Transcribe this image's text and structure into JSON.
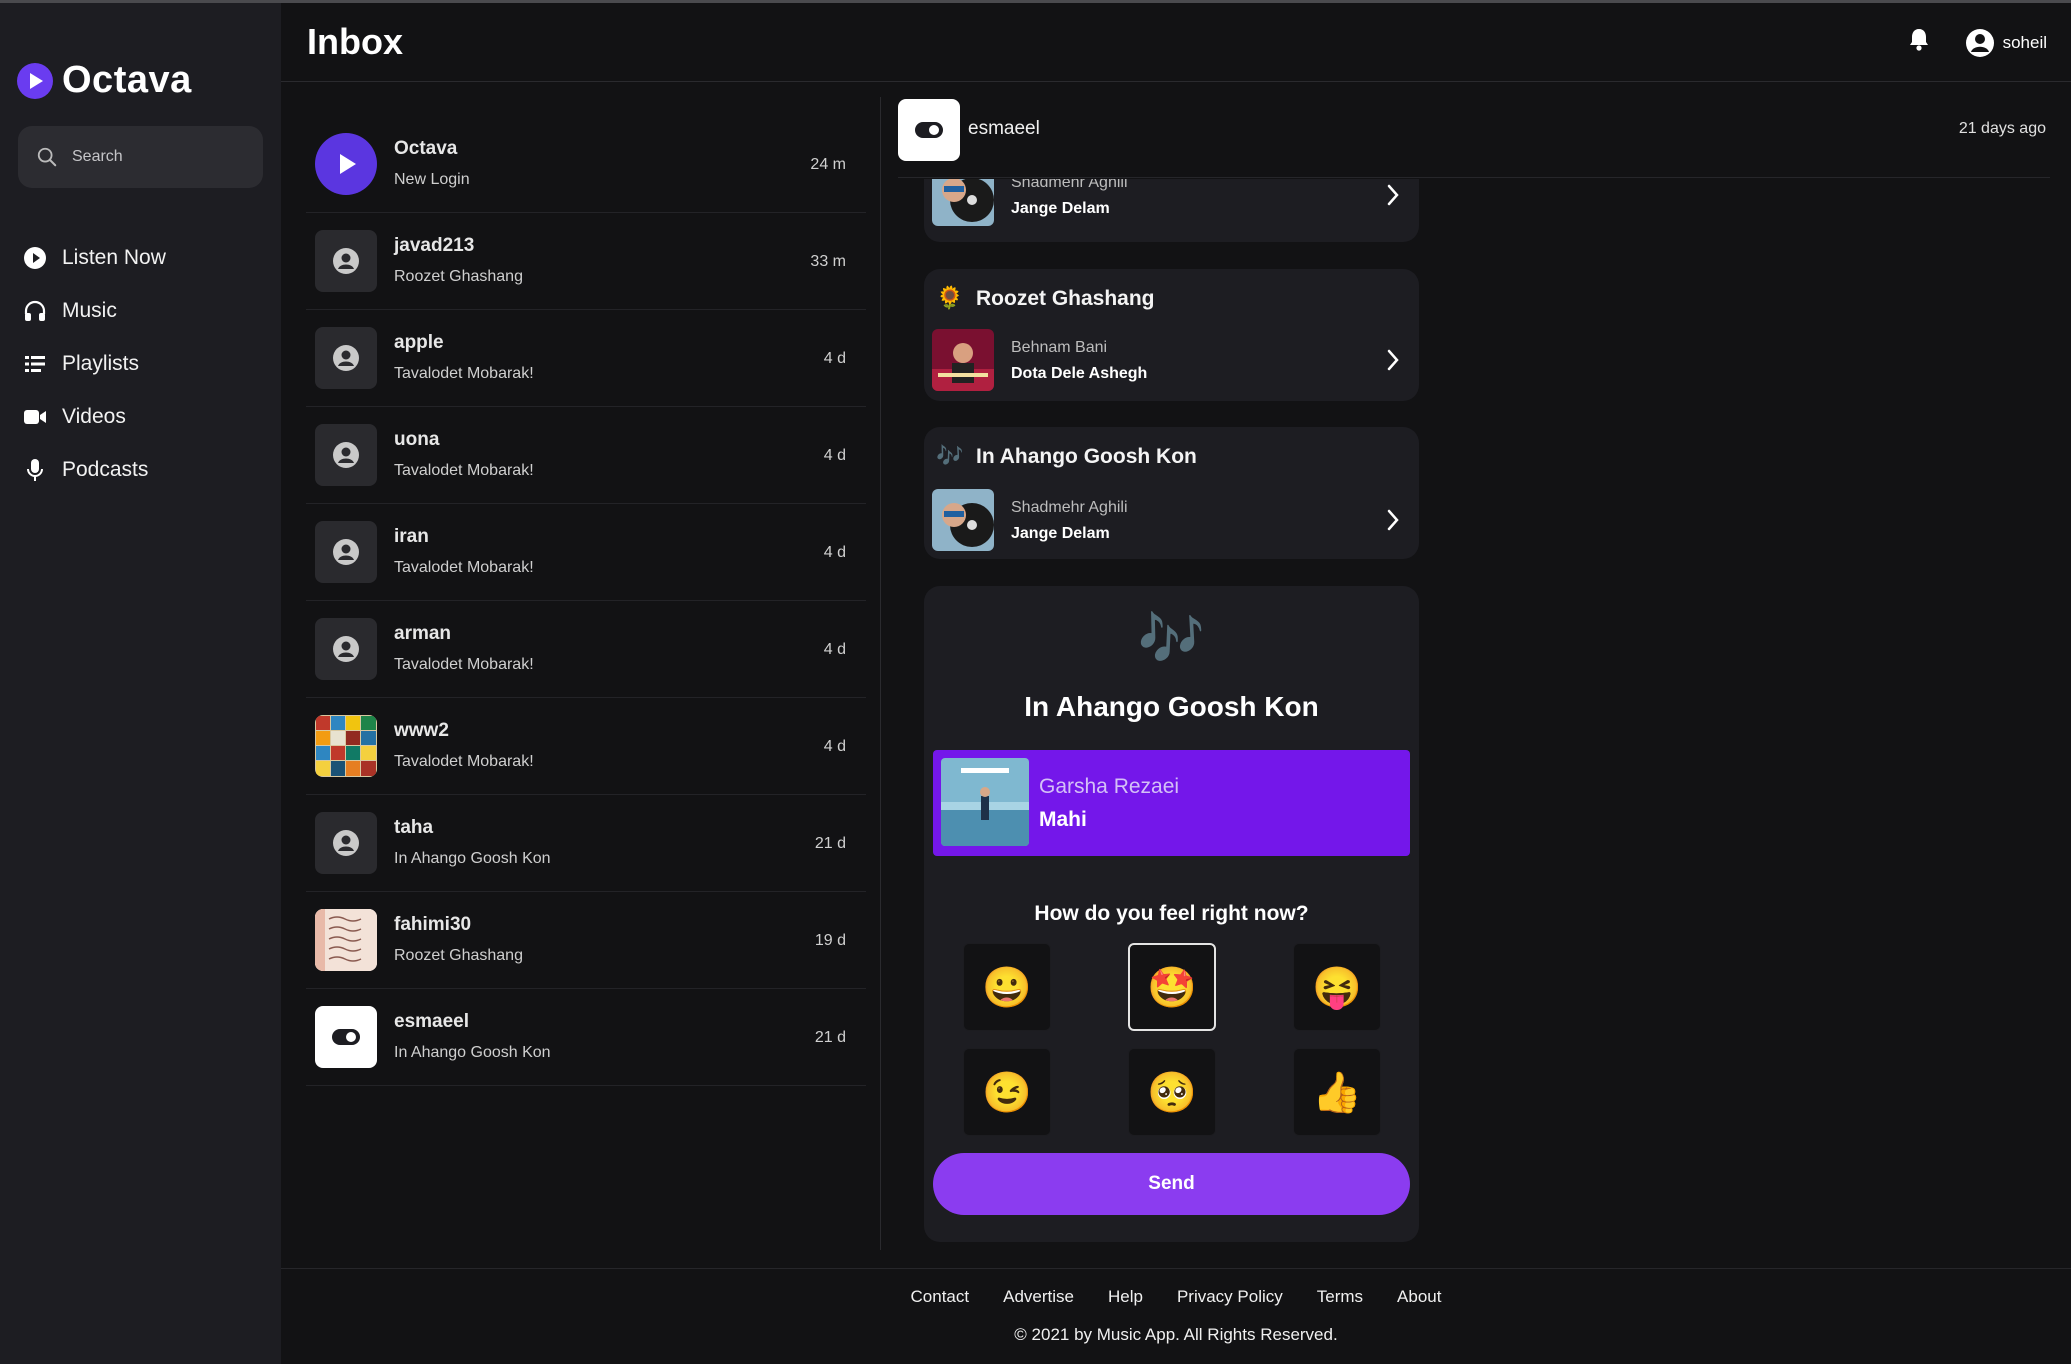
{
  "app": {
    "name": "Octava"
  },
  "search": {
    "placeholder": "Search"
  },
  "nav": [
    {
      "label": "Listen Now",
      "icon": "play-circle-icon"
    },
    {
      "label": "Music",
      "icon": "headphones-icon"
    },
    {
      "label": "Playlists",
      "icon": "playlist-icon"
    },
    {
      "label": "Videos",
      "icon": "video-camera-icon"
    },
    {
      "label": "Podcasts",
      "icon": "microphone-icon"
    }
  ],
  "header": {
    "title": "Inbox",
    "username": "soheil"
  },
  "messages": [
    {
      "name": "Octava",
      "text": "New Login",
      "time": "24 m"
    },
    {
      "name": "javad213",
      "text": "Roozet Ghashang",
      "time": "33 m"
    },
    {
      "name": "apple",
      "text": "Tavalodet Mobarak!",
      "time": "4 d"
    },
    {
      "name": "uona",
      "text": "Tavalodet Mobarak!",
      "time": "4 d"
    },
    {
      "name": "iran",
      "text": "Tavalodet Mobarak!",
      "time": "4 d"
    },
    {
      "name": "arman",
      "text": "Tavalodet Mobarak!",
      "time": "4 d"
    },
    {
      "name": "www2",
      "text": "Tavalodet Mobarak!",
      "time": "4 d"
    },
    {
      "name": "taha",
      "text": "In Ahango Goosh Kon",
      "time": "21 d"
    },
    {
      "name": "fahimi30",
      "text": "Roozet Ghashang",
      "time": "19 d"
    },
    {
      "name": "esmaeel",
      "text": "In Ahango Goosh Kon",
      "time": "21 d"
    }
  ],
  "conversation": {
    "name": "esmaeel",
    "time": "21 days ago",
    "cards": [
      {
        "title": "",
        "emoji": "",
        "artist": "Shadmehr Aghili",
        "song": "Jange Delam"
      },
      {
        "title": "Roozet Ghashang",
        "emoji": "🌻",
        "artist": "Behnam Bani",
        "song": "Dota Dele Ashegh"
      },
      {
        "title": "In Ahango Goosh Kon",
        "emoji": "🎶",
        "artist": "Shadmehr Aghili",
        "song": "Jange Delam"
      }
    ],
    "main": {
      "emoji": "🎶",
      "title": "In Ahango Goosh Kon",
      "artist": "Garsha Rezaei",
      "song": "Mahi",
      "question": "How do you feel right now?",
      "moods": [
        "😀",
        "🤩",
        "😝",
        "😉",
        "🥺",
        "👍"
      ],
      "selected_mood": 1,
      "send_label": "Send"
    }
  },
  "footer": {
    "links": [
      "Contact",
      "Advertise",
      "Help",
      "Privacy Policy",
      "Terms",
      "About"
    ],
    "copyright": "© 2021 by Music App. All Rights Reserved."
  },
  "colors": {
    "accent": "#7417ea",
    "button": "#8b3cf0",
    "sidebar": "#1d1d22",
    "background": "#121214"
  }
}
